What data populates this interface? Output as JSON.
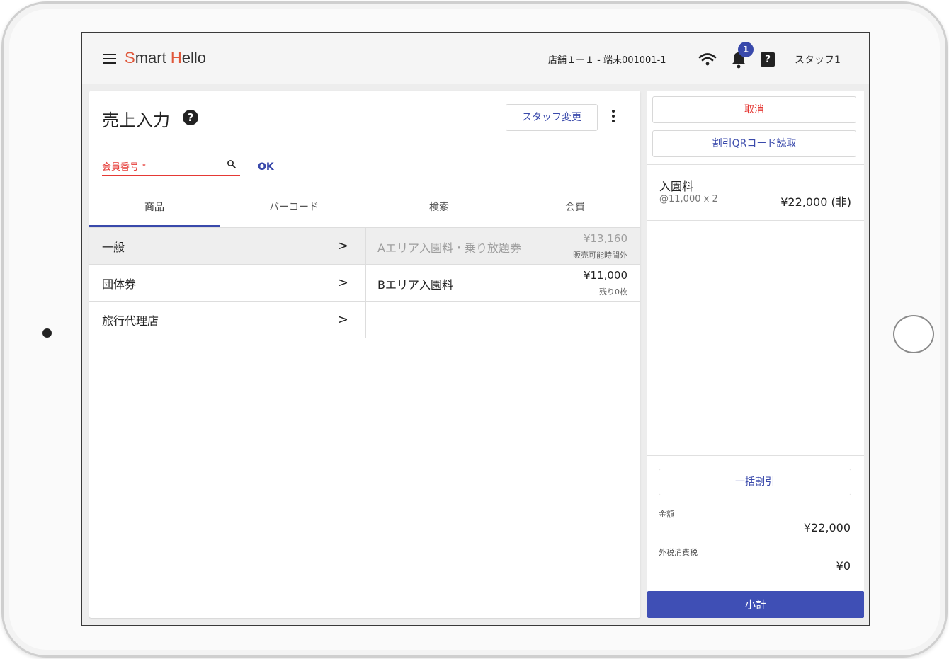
{
  "app": {
    "logo_s": "S",
    "logo_mart": "mart ",
    "logo_h": "H",
    "logo_ello": "ello",
    "store_terminal": "店舗１ー１ - 端末001001-1",
    "notification_count": "1",
    "staff_name": "スタッフ1",
    "accent_color": "#3949ab",
    "error_color": "#e53935",
    "brand_color": "#e0573a"
  },
  "header": {
    "title": "売上入力",
    "help_icon": "question-circle-icon",
    "staff_change_label": "スタッフ変更"
  },
  "member": {
    "label": "会員番号 *",
    "ok_label": "OK"
  },
  "tabs": [
    {
      "label": "商品"
    },
    {
      "label": "バーコード"
    },
    {
      "label": "検索"
    },
    {
      "label": "会費"
    }
  ],
  "categories": [
    {
      "label": "一般"
    },
    {
      "label": "団体券"
    },
    {
      "label": "旅行代理店"
    }
  ],
  "products": [
    {
      "name": "Aエリア入園料・乗り放題券",
      "price": "¥13,160",
      "note": "販売可能時間外"
    },
    {
      "name": "Bエリア入園料",
      "price": "¥11,000",
      "note": "残り0枚"
    }
  ],
  "cart": {
    "cancel_label": "取消",
    "qr_label": "割引QRコード読取",
    "item_name": "入園料",
    "item_detail": "@11,000 x 2",
    "item_total": "¥22,000 (非)",
    "bulk_discount_label": "一括割引",
    "amount_label": "金額",
    "amount_value": "¥22,000",
    "tax_label": "外税消費税",
    "tax_value": "¥0",
    "subtotal_label": "小計"
  }
}
